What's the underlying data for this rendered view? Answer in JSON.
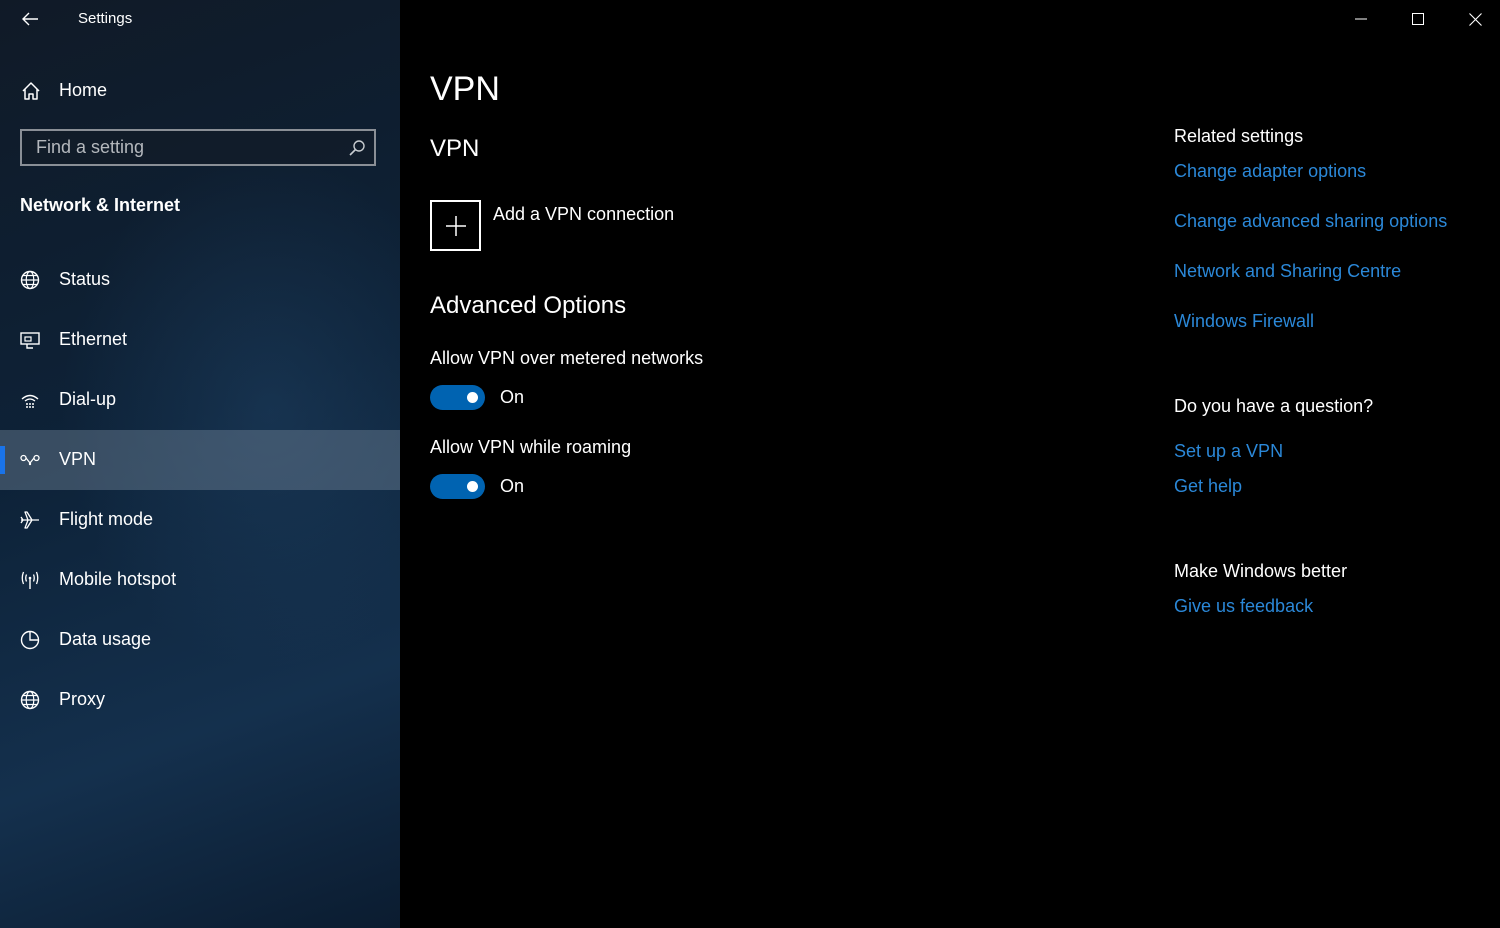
{
  "window": {
    "title": "Settings"
  },
  "sidebar": {
    "home_label": "Home",
    "search": {
      "placeholder": "Find a setting"
    },
    "section_title": "Network & Internet",
    "items": [
      {
        "label": "Status",
        "icon": "globe-status-icon"
      },
      {
        "label": "Ethernet",
        "icon": "ethernet-icon"
      },
      {
        "label": "Dial-up",
        "icon": "dialup-icon"
      },
      {
        "label": "VPN",
        "icon": "vpn-icon",
        "selected": true
      },
      {
        "label": "Flight mode",
        "icon": "airplane-icon"
      },
      {
        "label": "Mobile hotspot",
        "icon": "hotspot-icon"
      },
      {
        "label": "Data usage",
        "icon": "pie-chart-icon"
      },
      {
        "label": "Proxy",
        "icon": "globe-icon"
      }
    ]
  },
  "main": {
    "page_title": "VPN",
    "section_title": "VPN",
    "add_vpn_label": "Add a VPN connection",
    "advanced_title": "Advanced Options",
    "options": [
      {
        "label": "Allow VPN over metered networks",
        "state": "On"
      },
      {
        "label": "Allow VPN while roaming",
        "state": "On"
      }
    ]
  },
  "right": {
    "related_title": "Related settings",
    "related_links": [
      "Change adapter options",
      "Change advanced sharing options",
      "Network and Sharing Centre",
      "Windows Firewall"
    ],
    "question_title": "Do you have a question?",
    "question_links": [
      "Set up a VPN",
      "Get help"
    ],
    "better_title": "Make Windows better",
    "better_links": [
      "Give us feedback"
    ]
  },
  "colors": {
    "accent": "#0063b1",
    "link": "#2b88d8",
    "selected_bar": "#1a73e8"
  }
}
